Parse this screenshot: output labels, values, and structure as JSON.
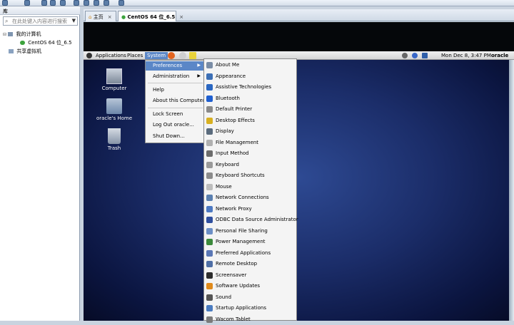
{
  "library": {
    "title": "库",
    "close_glyph": "✕",
    "search_placeholder": "在此处键入内容进行搜索",
    "tree": [
      {
        "label": "我的计算机"
      },
      {
        "label": "CentOS 64 位_6.5"
      },
      {
        "label": "共享虚拟机"
      }
    ]
  },
  "tabs": [
    {
      "label": "主页",
      "close": "×"
    },
    {
      "label": "CentOS 64 位_6.5",
      "close": "×"
    }
  ],
  "gnome_panel": {
    "menus": [
      "Applications",
      "Places",
      "System"
    ],
    "clock": "Mon Dec  8,  3:47 PM",
    "user": "oracle"
  },
  "desktop_icons": [
    {
      "label": "Computer"
    },
    {
      "label": "oracle's Home"
    },
    {
      "label": "Trash"
    }
  ],
  "system_menu": [
    {
      "label": "Preferences",
      "arrow": "▶"
    },
    {
      "label": "Administration",
      "arrow": "▶"
    },
    {
      "label": "Help"
    },
    {
      "label": "About this Computer"
    },
    {
      "label": "Lock Screen"
    },
    {
      "label": "Log Out oracle..."
    },
    {
      "label": "Shut Down..."
    }
  ],
  "preferences_menu": [
    {
      "label": "About Me",
      "color": "#7a8da6"
    },
    {
      "label": "Appearance",
      "color": "#3c6fb5"
    },
    {
      "label": "Assistive Technologies",
      "color": "#2a67c2"
    },
    {
      "label": "Bluetooth",
      "color": "#1f5fd0"
    },
    {
      "label": "Default Printer",
      "color": "#8a8a8a"
    },
    {
      "label": "Desktop Effects",
      "color": "#d8b020"
    },
    {
      "label": "Display",
      "color": "#5a6b7d"
    },
    {
      "label": "File Management",
      "color": "#b0b0b0"
    },
    {
      "label": "Input Method",
      "color": "#6c6c6c"
    },
    {
      "label": "Keyboard",
      "color": "#9a9a9a"
    },
    {
      "label": "Keyboard Shortcuts",
      "color": "#8c8c8c"
    },
    {
      "label": "Mouse",
      "color": "#bdbdbd"
    },
    {
      "label": "Network Connections",
      "color": "#5a7fb0"
    },
    {
      "label": "Network Proxy",
      "color": "#4d79c2"
    },
    {
      "label": "ODBC Data Source Administrator",
      "color": "#2f4f9e"
    },
    {
      "label": "Personal File Sharing",
      "color": "#6c8fc6"
    },
    {
      "label": "Power Management",
      "color": "#3c8a3c"
    },
    {
      "label": "Preferred Applications",
      "color": "#5a77b5"
    },
    {
      "label": "Remote Desktop",
      "color": "#4f6fa6"
    },
    {
      "label": "Screensaver",
      "color": "#2d2d2d"
    },
    {
      "label": "Software Updates",
      "color": "#e08a1c"
    },
    {
      "label": "Sound",
      "color": "#555"
    },
    {
      "label": "Startup Applications",
      "color": "#4a7bc0"
    },
    {
      "label": "Wacom Tablet",
      "color": "#7a7a7a"
    }
  ]
}
